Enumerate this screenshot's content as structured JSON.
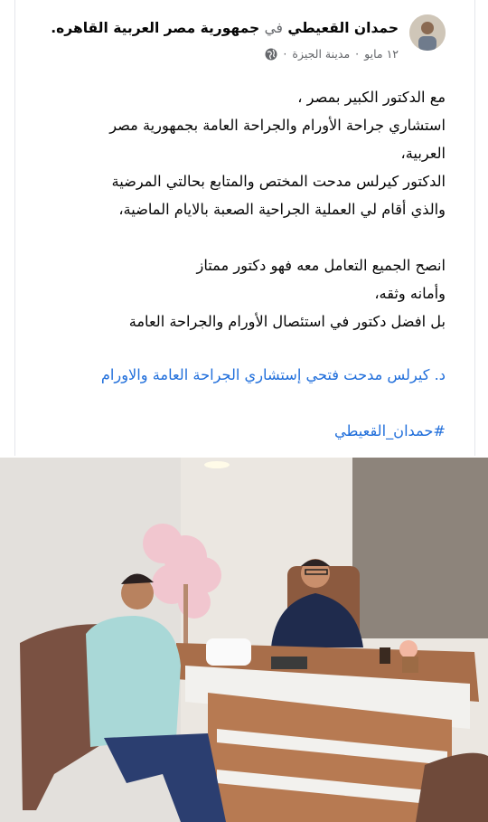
{
  "post": {
    "author": "حمدان القعيطي",
    "in_word": "في",
    "location": "جمهورية مصر العربية القاهره.",
    "date": "١٢ مايو",
    "separator": "·",
    "place": "مدينة الجيزة",
    "separator2": "·",
    "privacy_icon": "globe-icon",
    "lines": [
      "مع الدكتور الكبير بمصر ،",
      "استشاري جراحة الأورام والجراحة العامة بجمهورية مصر",
      "العربية،",
      "الدكتور كيرلس مدحت  المختص والمتابع بحالتي المرضية",
      "والذي أقام لي العملية الجراحية الصعبة بالايام الماضية،"
    ],
    "lines2": [
      "انصح الجميع التعامل معه فهو دكتور ممتاز",
      "وأمانه وثقه،",
      "بل افضل دكتور في استئصال الأورام والجراحة العامة"
    ],
    "link_text": "د. كيرلس مدحت فتحي إستشاري الجراحة العامة والاورام",
    "hashtag": "#حمدان_القعيطي",
    "link_color": "#216fdb"
  }
}
